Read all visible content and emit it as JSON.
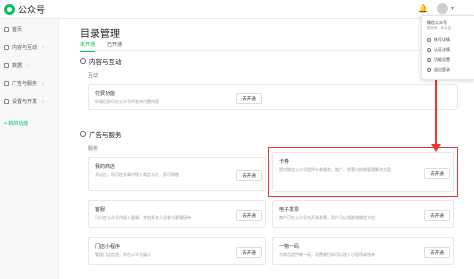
{
  "app": {
    "title": "公众号"
  },
  "sidebar": {
    "items": [
      {
        "label": "首页",
        "icon": "home-icon"
      },
      {
        "label": "内容与互动",
        "icon": "content-icon",
        "arrow": "›"
      },
      {
        "label": "数据",
        "icon": "data-icon",
        "arrow": "›"
      },
      {
        "label": "广告与服务",
        "icon": "ad-icon",
        "arrow": "›"
      },
      {
        "label": "设置与开发",
        "icon": "settings-icon",
        "arrow": "›"
      }
    ],
    "new_function": "+ 新的功能"
  },
  "main": {
    "page_title": "目录管理",
    "tabs": [
      {
        "label": "未开通",
        "active": true
      },
      {
        "label": "已开通",
        "active": false
      }
    ],
    "sections": [
      {
        "title": "内容与互动",
        "group": "互动",
        "cards": [
          {
            "title": "付费功能",
            "desc": "申请后即可在公众号中发布付费内容",
            "button": "去开通"
          }
        ]
      },
      {
        "title": "广告与服务",
        "group": "服务",
        "cards": [
          {
            "title": "我的商店",
            "desc": "开店后，你可在文章中插入商品卡片，即可销售",
            "button": "去开通"
          },
          {
            "title": "卡券",
            "desc": "是对微信公众号提供卡券服务，推广、经营与核销管理解决方案",
            "button": "去开通"
          },
          {
            "title": "客服",
            "desc": "可以在公众号内接入客服，并由多名人员参与客服接待",
            "button": "去开通"
          },
          {
            "title": "电子发票",
            "desc": "商户可在公众号内开具发票，用户可以领取到微信卡包",
            "button": "去开通"
          },
          {
            "title": "门店小程序",
            "desc": "管理门店信息，并在公众号展示",
            "button": "去开通"
          },
          {
            "title": "一物一码",
            "desc": "为商品提供唯一码，消费者扫码可以进入小程序或领券",
            "button": "去开通"
          }
        ]
      }
    ]
  },
  "dropdown": {
    "name": "微信公众号",
    "sub": "服务号 · 未认证",
    "items": [
      {
        "label": "帐号详情",
        "icon": "account-icon"
      },
      {
        "label": "认证详情",
        "icon": "verify-icon"
      },
      {
        "label": "功能设置",
        "icon": "gear-icon"
      },
      {
        "label": "退出登录",
        "icon": "logout-icon"
      }
    ]
  },
  "colors": {
    "accent": "#07c160",
    "highlight": "#e53935"
  }
}
